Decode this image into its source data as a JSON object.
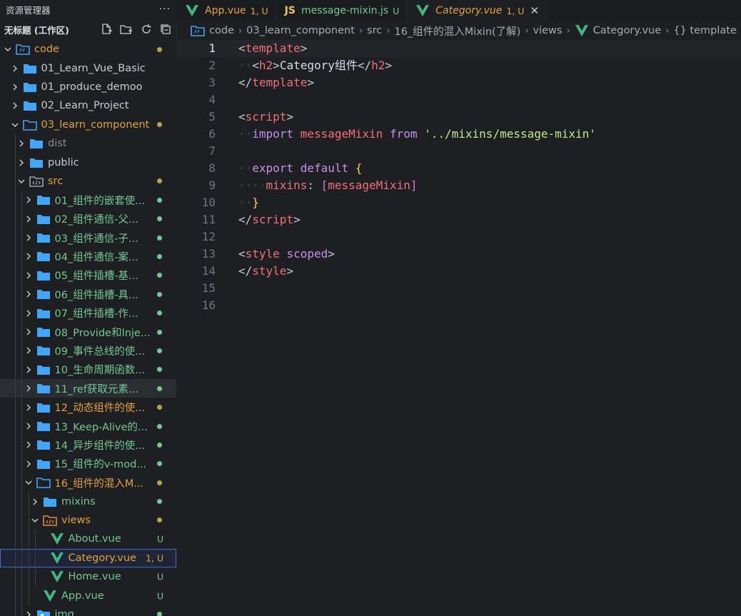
{
  "explorer": {
    "title": "资源管理器",
    "more": "···",
    "workspace": "无标题 (工作区)"
  },
  "colors": {
    "modified": "#b5a450",
    "untracked": "#73c991",
    "folder": "#42a5f5",
    "vue": "#41b883",
    "js": "#e8c95c"
  },
  "tree": [
    {
      "label": "code",
      "icon": "root-folder-icon",
      "chev": "down",
      "indent": 0,
      "color": "#e2a33d",
      "dot": "modified"
    },
    {
      "label": "01_Learn_Vue_Basic",
      "icon": "folder-icon",
      "chev": "right",
      "indent": 1,
      "color": "#cccccc"
    },
    {
      "label": "01_produce_demoo",
      "icon": "folder-icon",
      "chev": "right",
      "indent": 1,
      "color": "#cccccc"
    },
    {
      "label": "02_Learn_Project",
      "icon": "folder-icon",
      "chev": "right",
      "indent": 1,
      "color": "#cccccc"
    },
    {
      "label": "03_learn_component",
      "icon": "folder-open-icon",
      "chev": "down",
      "indent": 1,
      "color": "#e2a33d",
      "dot": "modified"
    },
    {
      "label": "dist",
      "icon": "folder-icon",
      "chev": "right",
      "indent": 2,
      "color": "#8c8c8c"
    },
    {
      "label": "public",
      "icon": "folder-icon",
      "chev": "right",
      "indent": 2,
      "color": "#cccccc"
    },
    {
      "label": "src",
      "icon": "src-folder-icon",
      "chev": "down",
      "indent": 2,
      "color": "#e2a33d",
      "dot": "modified"
    },
    {
      "label": "01_组件的嵌套使...",
      "icon": "folder-icon",
      "chev": "right",
      "indent": 3,
      "color": "#73c991",
      "dot": "untracked"
    },
    {
      "label": "02_组件通信-父...",
      "icon": "folder-icon",
      "chev": "right",
      "indent": 3,
      "color": "#73c991",
      "dot": "untracked"
    },
    {
      "label": "03_组件通信-子...",
      "icon": "folder-icon",
      "chev": "right",
      "indent": 3,
      "color": "#73c991",
      "dot": "untracked"
    },
    {
      "label": "04_组件通信-案...",
      "icon": "folder-icon",
      "chev": "right",
      "indent": 3,
      "color": "#73c991",
      "dot": "untracked"
    },
    {
      "label": "05_组件插槽-基...",
      "icon": "folder-icon",
      "chev": "right",
      "indent": 3,
      "color": "#73c991",
      "dot": "untracked"
    },
    {
      "label": "06_组件插槽-具...",
      "icon": "folder-icon",
      "chev": "right",
      "indent": 3,
      "color": "#73c991",
      "dot": "untracked"
    },
    {
      "label": "07_组件插槽-作...",
      "icon": "folder-icon",
      "chev": "right",
      "indent": 3,
      "color": "#73c991",
      "dot": "untracked"
    },
    {
      "label": "08_Provide和Inje...",
      "icon": "folder-icon",
      "chev": "right",
      "indent": 3,
      "color": "#73c991",
      "dot": "untracked"
    },
    {
      "label": "09_事件总线的使...",
      "icon": "folder-icon",
      "chev": "right",
      "indent": 3,
      "color": "#73c991",
      "dot": "untracked"
    },
    {
      "label": "10_生命周期函数...",
      "icon": "folder-icon",
      "chev": "right",
      "indent": 3,
      "color": "#73c991",
      "dot": "untracked"
    },
    {
      "label": "11_ref获取元素...",
      "icon": "folder-icon",
      "chev": "right",
      "indent": 3,
      "color": "#73c991",
      "dot": "untracked",
      "hovered": true
    },
    {
      "label": "12_动态组件的使...",
      "icon": "folder-icon",
      "chev": "right",
      "indent": 3,
      "color": "#e2a33d",
      "dot": "modified"
    },
    {
      "label": "13_Keep-Alive的...",
      "icon": "folder-icon",
      "chev": "right",
      "indent": 3,
      "color": "#73c991",
      "dot": "untracked"
    },
    {
      "label": "14_异步组件的使...",
      "icon": "folder-icon",
      "chev": "right",
      "indent": 3,
      "color": "#73c991",
      "dot": "untracked"
    },
    {
      "label": "15_组件的v-mod...",
      "icon": "folder-icon",
      "chev": "right",
      "indent": 3,
      "color": "#73c991",
      "dot": "untracked"
    },
    {
      "label": "16_组件的混入M...",
      "icon": "folder-open-icon",
      "chev": "down",
      "indent": 3,
      "color": "#e2a33d",
      "dot": "modified"
    },
    {
      "label": "mixins",
      "icon": "folder-icon",
      "chev": "right",
      "indent": 4,
      "color": "#73c991",
      "dot": "untracked"
    },
    {
      "label": "views",
      "icon": "views-folder-icon",
      "chev": "down",
      "indent": 4,
      "color": "#e2a33d",
      "dot": "modified"
    },
    {
      "label": "About.vue",
      "icon": "vue-file-icon",
      "indent": 5,
      "color": "#73c991",
      "badge": "U"
    },
    {
      "label": "Category.vue",
      "icon": "vue-file-icon",
      "indent": 5,
      "color": "#e2a33d",
      "badge": "1, U",
      "selected": true
    },
    {
      "label": "Home.vue",
      "icon": "vue-file-icon",
      "indent": 5,
      "color": "#73c991",
      "badge": "U"
    },
    {
      "label": "App.vue",
      "icon": "vue-file-icon",
      "indent": 4,
      "color": "#73c991",
      "badge": "U"
    },
    {
      "label": "img",
      "icon": "img-folder-icon",
      "chev": "right",
      "indent": 3,
      "color": "#73c991",
      "dot": "untracked"
    }
  ],
  "tabs": [
    {
      "name": "tab-app-vue",
      "label": "App.vue",
      "status": "1, U",
      "icon": "vue",
      "color": "#e2a33d",
      "italic": false,
      "active": false
    },
    {
      "name": "tab-message-mixin-js",
      "label": "message-mixin.js",
      "status": "U",
      "icon": "js",
      "color": "#73c991",
      "italic": false,
      "active": false
    },
    {
      "name": "tab-category-vue",
      "label": "Category.vue",
      "status": "1, U",
      "icon": "vue",
      "color": "#e2a33d",
      "italic": true,
      "active": true,
      "close": "✕"
    }
  ],
  "breadcrumb": [
    "code",
    "03_learn_component",
    "src",
    "16_组件的混入Mixin(了解)",
    "views",
    "Category.vue",
    "{} template"
  ],
  "breadcrumb_sep": "›",
  "line_numbers": [
    "1",
    "2",
    "3",
    "4",
    "5",
    "6",
    "7",
    "8",
    "9",
    "10",
    "11",
    "12",
    "13",
    "14",
    "15",
    "16"
  ],
  "code_lines": [
    [
      [
        "tok-punc",
        "<"
      ],
      [
        "tok-tag",
        "template"
      ],
      [
        "tok-punc",
        ">"
      ]
    ],
    [
      [
        "ws-dot",
        "··"
      ],
      [
        "tok-punc",
        "<"
      ],
      [
        "tok-tag",
        "h2"
      ],
      [
        "tok-punc",
        ">"
      ],
      [
        "tok-text",
        "Category组件"
      ],
      [
        "tok-punc",
        "</"
      ],
      [
        "tok-tag",
        "h2"
      ],
      [
        "tok-punc",
        ">"
      ]
    ],
    [
      [
        "tok-punc",
        "</"
      ],
      [
        "tok-tag",
        "template"
      ],
      [
        "tok-punc",
        ">"
      ]
    ],
    [],
    [
      [
        "tok-punc",
        "<"
      ],
      [
        "tok-tag",
        "script"
      ],
      [
        "tok-punc",
        ">"
      ]
    ],
    [
      [
        "ws-dot",
        "··"
      ],
      [
        "tok-kw",
        "import"
      ],
      [
        "tok-text",
        " "
      ],
      [
        "tok-id",
        "messageMixin"
      ],
      [
        "tok-text",
        " "
      ],
      [
        "tok-kw",
        "from"
      ],
      [
        "tok-text",
        " "
      ],
      [
        "tok-str",
        "'../mixins/message-mixin'"
      ]
    ],
    [],
    [
      [
        "ws-dot",
        "··"
      ],
      [
        "tok-kw",
        "export"
      ],
      [
        "tok-text",
        " "
      ],
      [
        "tok-kw",
        "default"
      ],
      [
        "tok-text",
        " "
      ],
      [
        "tok-brace",
        "{"
      ]
    ],
    [
      [
        "ws-dot",
        "····"
      ],
      [
        "tok-id",
        "mixins"
      ],
      [
        "tok-punc",
        ":"
      ],
      [
        "tok-text",
        " "
      ],
      [
        "tok-bracket",
        "["
      ],
      [
        "tok-id",
        "messageMixin"
      ],
      [
        "tok-bracket",
        "]"
      ]
    ],
    [
      [
        "ws-dot",
        "··"
      ],
      [
        "tok-brace",
        "}"
      ]
    ],
    [
      [
        "tok-punc",
        "</"
      ],
      [
        "tok-tag",
        "script"
      ],
      [
        "tok-punc",
        ">"
      ]
    ],
    [],
    [
      [
        "tok-punc",
        "<"
      ],
      [
        "tok-tag",
        "style"
      ],
      [
        "tok-text",
        " "
      ],
      [
        "tok-attr",
        "scoped"
      ],
      [
        "tok-punc",
        ">"
      ]
    ],
    [
      [
        "tok-punc",
        "</"
      ],
      [
        "tok-tag",
        "style"
      ],
      [
        "tok-punc",
        ">"
      ]
    ],
    [],
    []
  ],
  "current_line": 1
}
